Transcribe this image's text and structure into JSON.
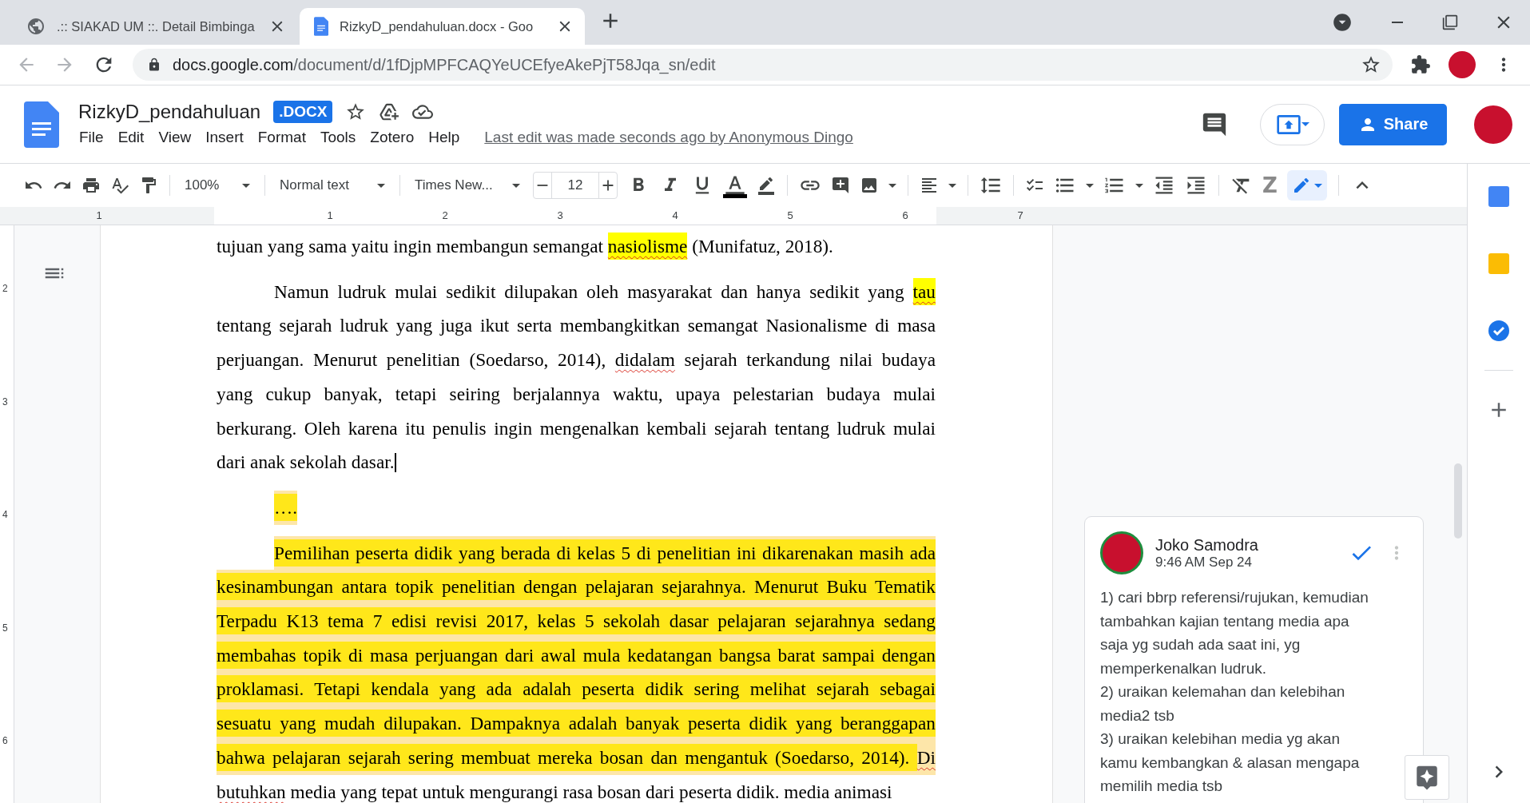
{
  "browser": {
    "tabs": [
      {
        "title": ".:: SIAKAD UM ::. Detail Bimbinga",
        "kind": "web",
        "selected": false
      },
      {
        "title": "RizkyD_pendahuluan.docx - Goo",
        "kind": "docs",
        "selected": true
      }
    ],
    "address": {
      "host": "docs.google.com",
      "path": "/document/d/1fDjpMPFCAQYeUCEfyeAkePjT58Jqa_sn/edit"
    }
  },
  "header": {
    "title": "RizkyD_pendahuluan",
    "badge": ".DOCX",
    "menu": [
      "File",
      "Edit",
      "View",
      "Insert",
      "Format",
      "Tools",
      "Zotero",
      "Help"
    ],
    "last_edit": "Last edit was made seconds ago by Anonymous Dingo",
    "share": "Share"
  },
  "toolbar": {
    "zoom": "100%",
    "style": "Normal text",
    "font": "Times New...",
    "font_size": "12",
    "zotero": "Z",
    "editing_mode_selected": true
  },
  "ruler": {
    "left_label": "1",
    "labels": [
      "1",
      "2",
      "3",
      "4",
      "5",
      "6",
      "7"
    ]
  },
  "vertical_ruler": [
    "2",
    "3",
    "4",
    "5",
    "6"
  ],
  "paragraphs": [
    {
      "indent": false,
      "cursor_at_end": false,
      "lines": [
        {
          "commented": false,
          "segments": [
            {
              "text": "tujuan yang sama yaitu ingin membangun semangat ",
              "highlight": false,
              "misspelled": false
            },
            {
              "text": "nasiolisme",
              "highlight": true,
              "misspelled": true
            },
            {
              "text": " (Munifatuz, 2018).",
              "highlight": false,
              "misspelled": false
            }
          ]
        }
      ]
    },
    {
      "indent": true,
      "cursor_at_end": true,
      "lines": [
        {
          "commented": false,
          "segments": [
            {
              "text": "Namun ludruk mulai sedikit dilupakan oleh masyarakat dan hanya sedikit yang ",
              "highlight": false,
              "misspelled": false
            },
            {
              "text": "tau",
              "highlight": true,
              "misspelled": true
            }
          ]
        },
        {
          "commented": false,
          "segments": [
            {
              "text": "tentang sejarah ludruk yang juga ikut serta membangkitkan semangat Nasionalisme di masa",
              "highlight": false,
              "misspelled": false
            }
          ]
        },
        {
          "commented": false,
          "segments": [
            {
              "text": "perjuangan. Menurut penelitian (Soedarso, 2014), ",
              "highlight": false,
              "misspelled": false
            },
            {
              "text": "didalam",
              "highlight": false,
              "misspelled": true
            },
            {
              "text": " sejarah terkandung nilai budaya",
              "highlight": false,
              "misspelled": false
            }
          ]
        },
        {
          "commented": false,
          "segments": [
            {
              "text": "yang cukup banyak, tetapi seiring berjalannya waktu, upaya pelestarian budaya mulai",
              "highlight": false,
              "misspelled": false
            }
          ]
        },
        {
          "commented": false,
          "segments": [
            {
              "text": "berkurang. Oleh karena itu penulis ingin mengenalkan kembali sejarah tentang ludruk mulai",
              "highlight": false,
              "misspelled": false
            }
          ]
        },
        {
          "commented": false,
          "segments": [
            {
              "text": "dari anak sekolah dasar.",
              "highlight": false,
              "misspelled": false
            }
          ]
        }
      ]
    },
    {
      "indent": true,
      "cursor_at_end": false,
      "lines": [
        {
          "commented": true,
          "segments": [
            {
              "text": "….",
              "highlight": true,
              "misspelled": false
            }
          ]
        }
      ]
    },
    {
      "indent": true,
      "cursor_at_end": false,
      "lines": [
        {
          "commented": true,
          "segments": [
            {
              "text": "Pemilihan peserta didik yang berada di kelas 5 di penelitian ini dikarenakan masih ada",
              "highlight": true,
              "misspelled": false
            }
          ]
        },
        {
          "commented": true,
          "segments": [
            {
              "text": "kesinambungan antara topik penelitian dengan pelajaran sejarahnya. Menurut Buku Tematik",
              "highlight": true,
              "misspelled": false
            }
          ]
        },
        {
          "commented": true,
          "segments": [
            {
              "text": "Terpadu K13 tema 7 edisi revisi 2017, kelas 5 sekolah dasar pelajaran sejarahnya sedang",
              "highlight": true,
              "misspelled": false
            }
          ]
        },
        {
          "commented": true,
          "segments": [
            {
              "text": "membahas topik di masa perjuangan dari awal mula kedatangan bangsa barat sampai dengan",
              "highlight": true,
              "misspelled": false
            }
          ]
        },
        {
          "commented": true,
          "segments": [
            {
              "text": "proklamasi. Tetapi kendala yang ada adalah peserta didik sering melihat sejarah sebagai",
              "highlight": true,
              "misspelled": false
            }
          ]
        },
        {
          "commented": true,
          "segments": [
            {
              "text": "sesuatu yang mudah dilupakan. Dampaknya adalah banyak peserta didik yang beranggapan",
              "highlight": true,
              "misspelled": false
            }
          ]
        },
        {
          "commented": true,
          "segments": [
            {
              "text": "bahwa pelajaran sejarah sering membuat mereka bosan dan mengantuk (Soedarso, 2014). ",
              "highlight": true,
              "misspelled": false
            },
            {
              "text": "Di",
              "highlight": false,
              "misspelled": true
            }
          ]
        },
        {
          "commented": false,
          "segments": [
            {
              "text": "butuhkan",
              "highlight": false,
              "misspelled": true
            },
            {
              "text": " media yang tepat untuk mengurangi rasa bosan dari peserta didik. media animasi",
              "highlight": false,
              "misspelled": false
            }
          ]
        }
      ]
    }
  ],
  "comment": {
    "author": "Joko Samodra",
    "time": "9:46 AM Sep 24",
    "body": "1) cari bbrp referensi/rujukan, kemudian\ntambahkan kajian tentang media apa\nsaja yg sudah ada saat ini, yg\nmemperkenalkan ludruk.\n2) uraikan kelemahan dan kelebihan\nmedia2 tsb\n3) uraikan kelebihan media yg akan\nkamu kembangkan & alasan mengapa\nmemilih media tsb"
  }
}
